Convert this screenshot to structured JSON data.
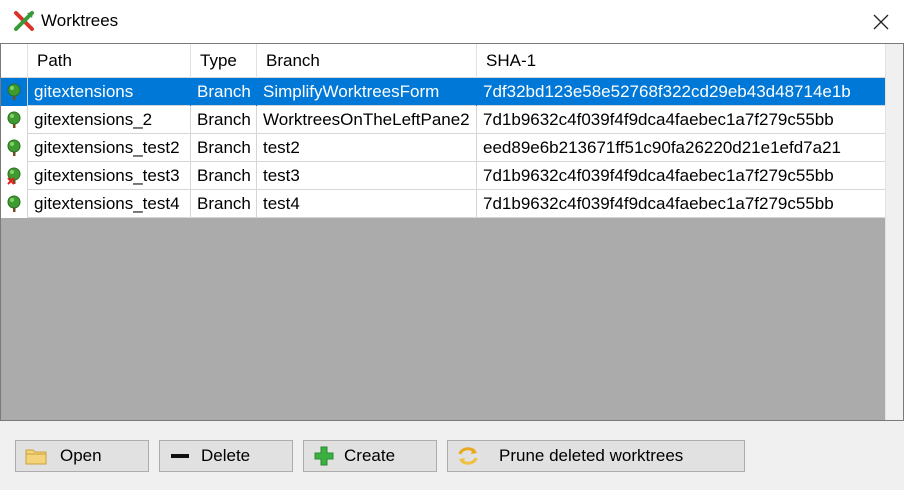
{
  "window": {
    "title": "Worktrees",
    "app_icon": "git-extensions-logo-icon",
    "close_icon": "close-icon"
  },
  "grid": {
    "columns": [
      "Path",
      "Type",
      "Branch",
      "SHA-1"
    ],
    "rows": [
      {
        "path": "gitextensions",
        "type": "Branch",
        "branch": "SimplifyWorktreesForm",
        "sha": "7df32bd123e58e52768f322cd29eb43d48714e1b",
        "icon": "tree-icon",
        "selected": true
      },
      {
        "path": "gitextensions_2",
        "type": "Branch",
        "branch": "WorktreesOnTheLeftPane2",
        "sha": "7d1b9632c4f039f4f9dca4faebec1a7f279c55bb",
        "icon": "tree-icon",
        "selected": false
      },
      {
        "path": "gitextensions_test2",
        "type": "Branch",
        "branch": "test2",
        "sha": "eed89e6b213671ff51c90fa26220d21e1efd7a21",
        "icon": "tree-icon",
        "selected": false
      },
      {
        "path": "gitextensions_test3",
        "type": "Branch",
        "branch": "test3",
        "sha": "7d1b9632c4f039f4f9dca4faebec1a7f279c55bb",
        "icon": "tree-deleted-icon",
        "selected": false
      },
      {
        "path": "gitextensions_test4",
        "type": "Branch",
        "branch": "test4",
        "sha": "7d1b9632c4f039f4f9dca4faebec1a7f279c55bb",
        "icon": "tree-icon",
        "selected": false
      }
    ]
  },
  "buttons": {
    "open": {
      "label": "Open",
      "icon": "folder-icon"
    },
    "delete": {
      "label": "Delete",
      "icon": "minus-icon"
    },
    "create": {
      "label": "Create",
      "icon": "plus-icon"
    },
    "prune": {
      "label": "Prune deleted worktrees",
      "icon": "refresh-arrows-icon"
    }
  },
  "colors": {
    "selection": "#0078d7",
    "empty_area": "#ababab",
    "button_bg": "#e1e1e1"
  }
}
